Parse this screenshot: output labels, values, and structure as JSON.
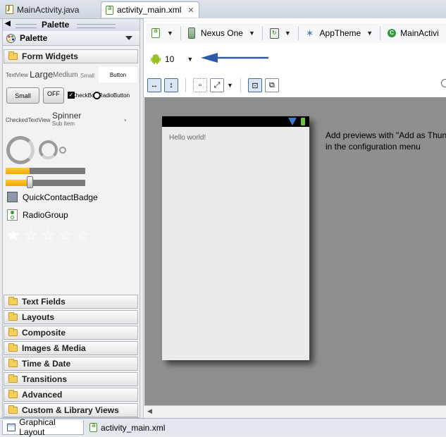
{
  "editor_tabs": [
    {
      "label": "MainActivity.java",
      "icon": "java-file-icon"
    },
    {
      "label": "activity_main.xml",
      "icon": "xml-file-icon",
      "active": true
    }
  ],
  "palette": {
    "header": "Palette",
    "menu_label": "Palette",
    "open_category": "Form Widgets",
    "widgets": {
      "textview": "TextView",
      "large": "Large",
      "medium": "Medium",
      "small": "Small",
      "button": "Button",
      "small_button": "Small",
      "toggle": "OFF",
      "checkbox": "CheckBox",
      "radiobutton": "RadioButton",
      "checkedtextview": "CheckedTextView",
      "spinner": "Spinner",
      "spinner_sub": "Sub Item",
      "quickcontactbadge": "QuickContactBadge",
      "radiogroup": "RadioGroup",
      "progress_large": 0.7,
      "progress_medium": 0.45,
      "seekbar_value": 0.32,
      "rating_stars": 5,
      "rating_value": 1
    },
    "categories": [
      "Text Fields",
      "Layouts",
      "Composite",
      "Images & Media",
      "Time & Date",
      "Transitions",
      "Advanced",
      "Custom & Library Views"
    ]
  },
  "toolbar": {
    "device": "Nexus One",
    "theme": "AppTheme",
    "activity": "MainActivi",
    "api_level": "10"
  },
  "preview": {
    "hello_text": "Hello world!",
    "hint_line1": "Add previews with \"Add as Thun",
    "hint_line2": "in the configuration menu"
  },
  "bottom_tabs": [
    {
      "label": "Graphical Layout",
      "active": true
    },
    {
      "label": "activity_main.xml"
    }
  ],
  "colors": {
    "accent": "#2b5aa8",
    "android_green": "#97c024",
    "progress": "#f5b400"
  }
}
